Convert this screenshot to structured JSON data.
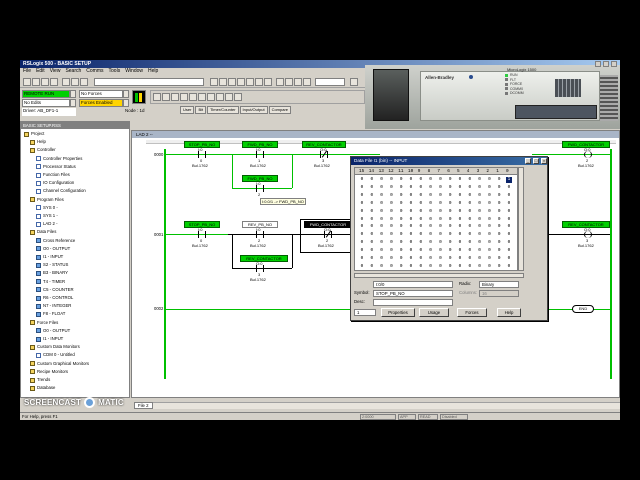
{
  "app": {
    "title": "RSLogix 500 - BASIC SETUP",
    "menu": [
      "File",
      "Edit",
      "View",
      "Search",
      "Comms",
      "Tools",
      "Window",
      "Help"
    ]
  },
  "status_panel": {
    "mode": "REMOTE RUN",
    "forces": "No Forces",
    "edits": "No Edits",
    "forces_enabled": "Forces Enabled",
    "driver": "Driver: AB_DF1-1",
    "node": "Node : 1d"
  },
  "instruction_tabs": [
    "User",
    "Bit",
    "Timer/Counter",
    "Input/Output",
    "Compare"
  ],
  "photo": {
    "brand": "Allen-Bradley",
    "model": "MicroLogix 1500",
    "leds": [
      "RUN",
      "FLT",
      "FORCE",
      "COMM0",
      "DCOMM"
    ]
  },
  "project_tree": {
    "title": "BASIC SETUP.RSS",
    "items": [
      {
        "label": "Project",
        "icon": "folder-icon",
        "indent": 0
      },
      {
        "label": "Help",
        "icon": "folder-icon",
        "indent": 1
      },
      {
        "label": "Controller",
        "icon": "folder-icon",
        "indent": 1
      },
      {
        "label": "Controller Properties",
        "icon": "doc-icon",
        "indent": 2
      },
      {
        "label": "Processor Status",
        "icon": "doc-icon",
        "indent": 2
      },
      {
        "label": "Function Files",
        "icon": "doc-icon",
        "indent": 2
      },
      {
        "label": "IO Configuration",
        "icon": "doc-icon",
        "indent": 2
      },
      {
        "label": "Channel Configuration",
        "icon": "doc-icon",
        "indent": 2
      },
      {
        "label": "Program Files",
        "icon": "folder-icon",
        "indent": 1
      },
      {
        "label": "SYS 0 -",
        "icon": "doc-icon",
        "indent": 2
      },
      {
        "label": "SYS 1 -",
        "icon": "doc-icon",
        "indent": 2
      },
      {
        "label": "LAD 2 -",
        "icon": "doc-icon",
        "indent": 2
      },
      {
        "label": "Data Files",
        "icon": "folder-icon",
        "indent": 1
      },
      {
        "label": "Cross Reference",
        "icon": "data-icon",
        "indent": 2
      },
      {
        "label": "O0 - OUTPUT",
        "icon": "data-icon",
        "indent": 2
      },
      {
        "label": "I1 - INPUT",
        "icon": "data-icon",
        "indent": 2
      },
      {
        "label": "S2 - STATUS",
        "icon": "data-icon",
        "indent": 2
      },
      {
        "label": "B3 - BINARY",
        "icon": "data-icon",
        "indent": 2
      },
      {
        "label": "T4 - TIMER",
        "icon": "data-icon",
        "indent": 2
      },
      {
        "label": "C5 - COUNTER",
        "icon": "data-icon",
        "indent": 2
      },
      {
        "label": "R6 - CONTROL",
        "icon": "data-icon",
        "indent": 2
      },
      {
        "label": "N7 - INTEGER",
        "icon": "data-icon",
        "indent": 2
      },
      {
        "label": "F8 - FLOAT",
        "icon": "data-icon",
        "indent": 2
      },
      {
        "label": "Force Files",
        "icon": "folder-icon",
        "indent": 1
      },
      {
        "label": "O0 - OUTPUT",
        "icon": "data-icon",
        "indent": 2
      },
      {
        "label": "I1 - INPUT",
        "icon": "data-icon",
        "indent": 2
      },
      {
        "label": "Custom Data Monitors",
        "icon": "folder-icon",
        "indent": 1
      },
      {
        "label": "CDM 0 - Untitled",
        "icon": "doc-icon",
        "indent": 2
      },
      {
        "label": "Custom Graphical Monitors",
        "icon": "folder-icon",
        "indent": 1
      },
      {
        "label": "Recipe Monitors",
        "icon": "folder-icon",
        "indent": 1
      },
      {
        "label": "Trends",
        "icon": "folder-icon",
        "indent": 1
      },
      {
        "label": "Database",
        "icon": "folder-icon",
        "indent": 1
      }
    ]
  },
  "ladder": {
    "window_title": "LAD 2 --",
    "rungs": [
      "0000",
      "0001",
      "0002"
    ],
    "r0": {
      "stop_tag": "STOP_PB_NO",
      "stop_addr": "I:0",
      "stop_bit": "0",
      "stop_mod": "Bul.1762",
      "fwd_tag": "FWD_PB_NO",
      "fwd_addr": "I:0",
      "fwd_bit": "1",
      "fwd_mod": "Bul.1762",
      "rev_tag": "REV_CONTACTOR",
      "rev_addr": "O:0",
      "rev_bit": "3",
      "rev_mod": "Bul.1762",
      "seal_tag": "FWD_PB_NO",
      "seal_addr": "I:0",
      "seal_bit": "2",
      "tooltip": "I:0.0/1 -> FWD_PB_NO",
      "out_tag": "FWD_CONTACTOR",
      "out_addr": "O:0",
      "out_bit": "2",
      "out_mod": "Bul.1762"
    },
    "r1": {
      "stop_tag": "STOP_PB_NO",
      "stop_addr": "I:0",
      "stop_bit": "0",
      "stop_mod": "Bul.1762",
      "rev_tag": "REV_PB_NO",
      "rev_addr": "I:0",
      "rev_bit": "2",
      "rev_mod": "Bul.1762",
      "fwd_tag": "FWD_CONTACTOR",
      "fwd_addr": "O:0",
      "fwd_bit": "2",
      "fwd_mod": "Bul.1762",
      "seal_tag": "REV_CONTACTOR",
      "seal_addr": "O:0",
      "seal_bit": "3",
      "seal_mod": "Bul.1762",
      "out_tag": "REV_CONTACTOR",
      "out_addr": "O:0",
      "out_bit": "3",
      "out_mod": "Bul.1762"
    },
    "end_label": "END",
    "file_tab": "File 2"
  },
  "data_dialog": {
    "title": "Data File I1 (bin) -- INPUT",
    "bit_headers": [
      "15",
      "14",
      "13",
      "12",
      "11",
      "10",
      "9",
      "8",
      "7",
      "6",
      "5",
      "4",
      "3",
      "2",
      "1",
      "0"
    ],
    "rows": [
      "0 0 0 0 0 0 0 0 0 0 0 0 0 0 0 1",
      "0 0 0 0 0 0 0 0 0 0 0 0 0 0 0 0",
      "0 0 0 0 0 0 0 0 0 0 0 0 0 0 0 0",
      "0 0 0 0 0 0 0 0 0 0 0 0 0 0 0 0",
      "0 0 0 0 0 0 0 0 0 0 0 0 0 0 0 0",
      "0 0 0 0 0 0 0 0 0 0 0 0 0 0 0 0",
      "0 0 0 0 0 0 0 0 0 0 0 0 0 0 0 0",
      "0 0 0 0 0 0 0 0 0 0 0 0 0 0 0 0",
      "0 0 0 0 0 0 0 0 0 0 0 0 0 0 0 0",
      "0 0 0 0 0 0 0 0 0 0 0 0 0 0 0 0",
      "0 0 0 0 0 0 0 0 0 0 0 0 0 0 0 0",
      "0 0 0 0 0 0 0 0 0 0 0 0 0 0 0 0"
    ],
    "address": "I:0/0",
    "radix_label": "Radix:",
    "radix": "Binary",
    "symbol_label": "Symbol:",
    "symbol": "STOP_PB_NO",
    "columns_label": "Columns:",
    "columns": "16",
    "desc_label": "Desc:",
    "file_num": "1",
    "buttons": [
      "Properties",
      "Usage",
      "Forces",
      "Help"
    ]
  },
  "statusbar": {
    "text": "For Help, press F1",
    "cells": [
      "2:0000",
      "APP",
      "READ",
      "Disabled"
    ]
  },
  "watermark": {
    "text": "SCREENCAST",
    "suffix": "MATIC"
  }
}
